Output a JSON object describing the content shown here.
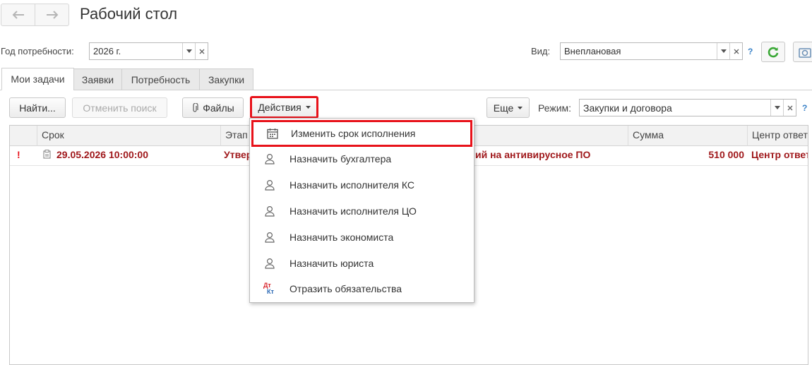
{
  "header": {
    "title": "Рабочий стол"
  },
  "filters": {
    "year_label": "Год потребности:",
    "year_value": "2026 г.",
    "kind_label": "Вид:",
    "kind_value": "Внеплановая",
    "help": "?"
  },
  "tabs": [
    {
      "label": "Мои задачи",
      "active": true
    },
    {
      "label": "Заявки"
    },
    {
      "label": "Потребность"
    },
    {
      "label": "Закупки"
    }
  ],
  "toolbar": {
    "find_label": "Найти...",
    "cancel_search_label": "Отменить поиск",
    "files_label": "Файлы",
    "actions_label": "Действия",
    "more_label": "Еще",
    "mode_label": "Режим:",
    "mode_value": "Закупки и договора",
    "help": "?"
  },
  "table": {
    "columns": [
      "Срок",
      "Этап",
      "Сумма",
      "Центр ответственности"
    ],
    "row": {
      "flag": "!",
      "deadline": "29.05.2026 10:00:00",
      "stage": "Утвер",
      "subject": "ий на антивирусное ПО",
      "amount": "510 000",
      "center": "Центр ответственности"
    }
  },
  "actions_menu": {
    "items": [
      {
        "label": "Изменить срок исполнения",
        "icon": "calendar-icon"
      },
      {
        "label": "Назначить бухгалтера",
        "icon": "person-icon"
      },
      {
        "label": "Назначить исполнителя КС",
        "icon": "person-icon"
      },
      {
        "label": "Назначить исполнителя ЦО",
        "icon": "person-icon"
      },
      {
        "label": "Назначить экономиста",
        "icon": "person-icon"
      },
      {
        "label": "Назначить юриста",
        "icon": "person-icon"
      },
      {
        "label": "Отразить обязательства",
        "icon": "dt-kt-icon"
      }
    ],
    "dt_kt_top": "Дт",
    "dt_kt_bottom": "Кт"
  },
  "colors": {
    "accent_red": "#e8121a",
    "row_text": "#a0191c",
    "refresh_green": "#3aa836",
    "help_blue": "#3a82c8"
  }
}
